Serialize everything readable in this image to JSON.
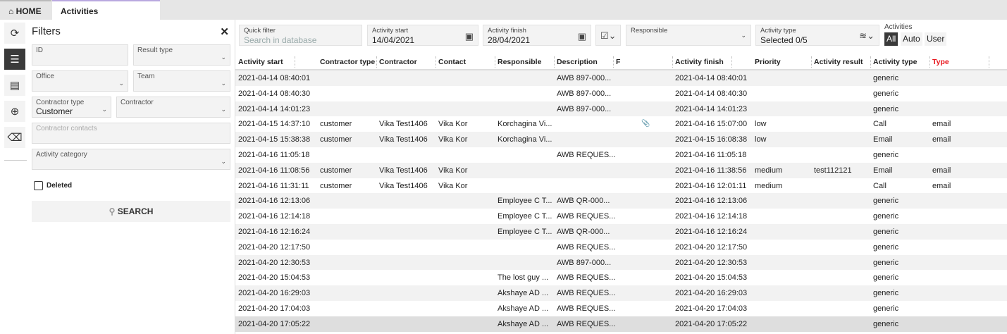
{
  "tabs": {
    "home": "HOME",
    "activities": "Activities"
  },
  "sidebar": {
    "icons": [
      "refresh-icon",
      "filter-sliders-icon",
      "spreadsheet-icon",
      "add-circle-icon",
      "eraser-icon"
    ]
  },
  "filters": {
    "title": "Filters",
    "id": "ID",
    "result_type": "Result type",
    "office": "Office",
    "team": "Team",
    "contractor_type": "Contractor type",
    "contractor_type_value": "Customer",
    "contractor": "Contractor",
    "contractor_contacts": "Contractor contacts",
    "activity_category": "Activity category",
    "deleted": "Deleted",
    "search": "SEARCH"
  },
  "toolbar": {
    "quick_filter": "Quick filter",
    "quick_filter_placeholder": "Search in database",
    "activity_start": "Activity start",
    "activity_start_value": "14/04/2021",
    "activity_finish": "Activity finish",
    "activity_finish_value": "28/04/2021",
    "responsible": "Responsible",
    "activity_type": "Activity type",
    "activity_type_value": "Selected 0/5",
    "activities": "Activities",
    "seg_all": "All",
    "seg_auto": "Auto",
    "seg_user": "User"
  },
  "colors": {
    "type_header": "#e8141b",
    "selected_segment": "#3a3a3a"
  },
  "columns": [
    "Activity start",
    "Contractor type",
    "Contractor",
    "Contact",
    "Responsible",
    "Description",
    "F",
    "Activity finish",
    "Priority",
    "Activity result",
    "Activity type",
    "Type"
  ],
  "rows": [
    [
      "2021-04-14 08:40:01",
      "",
      "",
      "",
      "",
      "AWB 897-000...",
      "",
      "2021-04-14 08:40:01",
      "",
      "",
      "generic",
      ""
    ],
    [
      "2021-04-14 08:40:30",
      "",
      "",
      "",
      "",
      "AWB 897-000...",
      "",
      "2021-04-14 08:40:30",
      "",
      "",
      "generic",
      ""
    ],
    [
      "2021-04-14 14:01:23",
      "",
      "",
      "",
      "",
      "AWB 897-000...",
      "",
      "2021-04-14 14:01:23",
      "",
      "",
      "generic",
      ""
    ],
    [
      "2021-04-15 14:37:10",
      "customer",
      "Vika Test1406",
      "Vika Kor",
      "Korchagina Vi...",
      "",
      "attachment",
      "2021-04-16 15:07:00",
      "low",
      "",
      "Call",
      "email"
    ],
    [
      "2021-04-15 15:38:38",
      "customer",
      "Vika Test1406",
      "Vika Kor",
      "Korchagina Vi...",
      "",
      "",
      "2021-04-15 16:08:38",
      "low",
      "",
      "Email",
      "email"
    ],
    [
      "2021-04-16 11:05:18",
      "",
      "",
      "",
      "",
      "AWB REQUES...",
      "",
      "2021-04-16 11:05:18",
      "",
      "",
      "generic",
      ""
    ],
    [
      "2021-04-16 11:08:56",
      "customer",
      "Vika Test1406",
      "Vika Kor",
      "",
      "",
      "",
      "2021-04-16 11:38:56",
      "medium",
      "test112121",
      "Email",
      "email"
    ],
    [
      "2021-04-16 11:31:11",
      "customer",
      "Vika Test1406",
      "Vika Kor",
      "",
      "",
      "",
      "2021-04-16 12:01:11",
      "medium",
      "",
      "Call",
      "email"
    ],
    [
      "2021-04-16 12:13:06",
      "",
      "",
      "",
      "Employee C T...",
      "AWB QR-000...",
      "",
      "2021-04-16 12:13:06",
      "",
      "",
      "generic",
      ""
    ],
    [
      "2021-04-16 12:14:18",
      "",
      "",
      "",
      "Employee C T...",
      "AWB REQUES...",
      "",
      "2021-04-16 12:14:18",
      "",
      "",
      "generic",
      ""
    ],
    [
      "2021-04-16 12:16:24",
      "",
      "",
      "",
      "Employee C T...",
      "AWB QR-000...",
      "",
      "2021-04-16 12:16:24",
      "",
      "",
      "generic",
      ""
    ],
    [
      "2021-04-20 12:17:50",
      "",
      "",
      "",
      "",
      "AWB REQUES...",
      "",
      "2021-04-20 12:17:50",
      "",
      "",
      "generic",
      ""
    ],
    [
      "2021-04-20 12:30:53",
      "",
      "",
      "",
      "",
      "AWB 897-000...",
      "",
      "2021-04-20 12:30:53",
      "",
      "",
      "generic",
      ""
    ],
    [
      "2021-04-20 15:04:53",
      "",
      "",
      "",
      "The lost guy ...",
      "AWB REQUES...",
      "",
      "2021-04-20 15:04:53",
      "",
      "",
      "generic",
      ""
    ],
    [
      "2021-04-20 16:29:03",
      "",
      "",
      "",
      "Akshaye AD ...",
      "AWB REQUES...",
      "",
      "2021-04-20 16:29:03",
      "",
      "",
      "generic",
      ""
    ],
    [
      "2021-04-20 17:04:03",
      "",
      "",
      "",
      "Akshaye AD ...",
      "AWB REQUES...",
      "",
      "2021-04-20 17:04:03",
      "",
      "",
      "generic",
      ""
    ],
    [
      "2021-04-20 17:05:22",
      "",
      "",
      "",
      "Akshaye AD ...",
      "AWB REQUES...",
      "",
      "2021-04-20 17:05:22",
      "",
      "",
      "generic",
      ""
    ]
  ]
}
